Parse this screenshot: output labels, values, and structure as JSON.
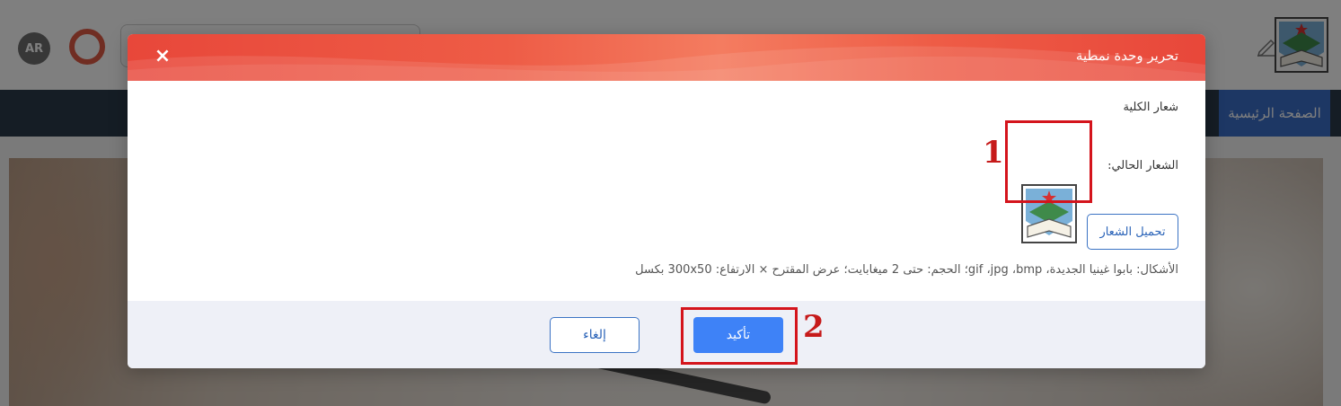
{
  "page": {
    "lang_badge": "AR",
    "nav_home_label": "الصفحة الرئيسية"
  },
  "modal": {
    "title": "تحرير وحدة نمطية",
    "close_icon": "×",
    "section_label": "شعار الكلية",
    "current_logo_label": "الشعار الحالي:",
    "upload_button": "تحميل الشعار",
    "hint": "الأشكال: بابوا غينيا الجديدة، gif ،jpg ،bmp؛ الحجم: حتى 2 ميغابايت؛ عرض المقترح × الارتفاع: 300x50 بكسل",
    "confirm_button": "تأكيد",
    "cancel_button": "إلغاء"
  },
  "annotations": {
    "marker_1": "1",
    "marker_2": "2",
    "color": "#d4141c"
  },
  "colors": {
    "header_red": "#e8473a",
    "primary_blue": "#3e82f7",
    "footer_bg": "#eef0f7",
    "nav_bg": "#2b3a4a"
  },
  "icons": {
    "close": "close-icon",
    "edit": "pencil-icon",
    "logo": "college-logo-icon"
  }
}
